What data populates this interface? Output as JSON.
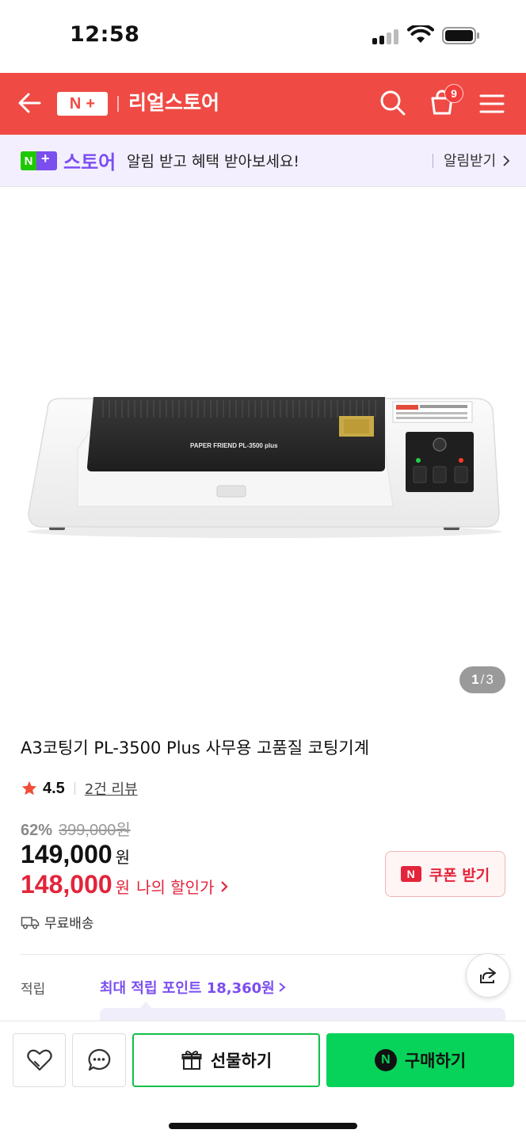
{
  "status": {
    "time": "12:58"
  },
  "header": {
    "logo_n": "N",
    "logo_plus": "+",
    "title": "리얼스토어",
    "cart_count": "9",
    "colors": {
      "brand_red": "#ef4a44"
    }
  },
  "promo": {
    "logo_n": "N",
    "logo_plus": "+",
    "store_label": "스토어",
    "message": "알림 받고 혜택 받아보세요!",
    "action_label": "알림받기",
    "colors": {
      "purple": "#7b4ef0",
      "green": "#1ec800"
    }
  },
  "gallery": {
    "current": "1",
    "separator": "/",
    "total": "3",
    "device_brand_text": "PAPER FRIEND PL-3500 plus"
  },
  "product": {
    "title": "A3코팅기 PL-3500 Plus 사무용 고품질 코팅기계",
    "rating": "4.5",
    "review_link": "2건 리뷰",
    "discount_rate": "62%",
    "original_price": "399,000원",
    "price": "149,000",
    "price_unit": "원",
    "my_price": "148,000",
    "my_price_unit": "원",
    "my_price_label": "나의 할인가",
    "coupon_icon": "N",
    "coupon_label": "쿠폰 받기",
    "shipping": "무료배송",
    "points_label": "적립",
    "points_value": "최대 적립 포인트 18,360원",
    "colors": {
      "sale_red": "#e3243b",
      "points_purple": "#7b4ef0"
    }
  },
  "bottom_bar": {
    "gift_label": "선물하기",
    "buy_icon": "N",
    "buy_label": "구매하기",
    "colors": {
      "buy_green": "#07d35a"
    }
  },
  "icons": [
    "back-arrow-icon",
    "search-icon",
    "cart-icon",
    "menu-icon",
    "chevron-right-icon",
    "star-icon",
    "truck-icon",
    "share-icon",
    "heart-icon",
    "chat-icon",
    "gift-icon",
    "wifi-icon",
    "battery-icon",
    "signal-icon"
  ]
}
